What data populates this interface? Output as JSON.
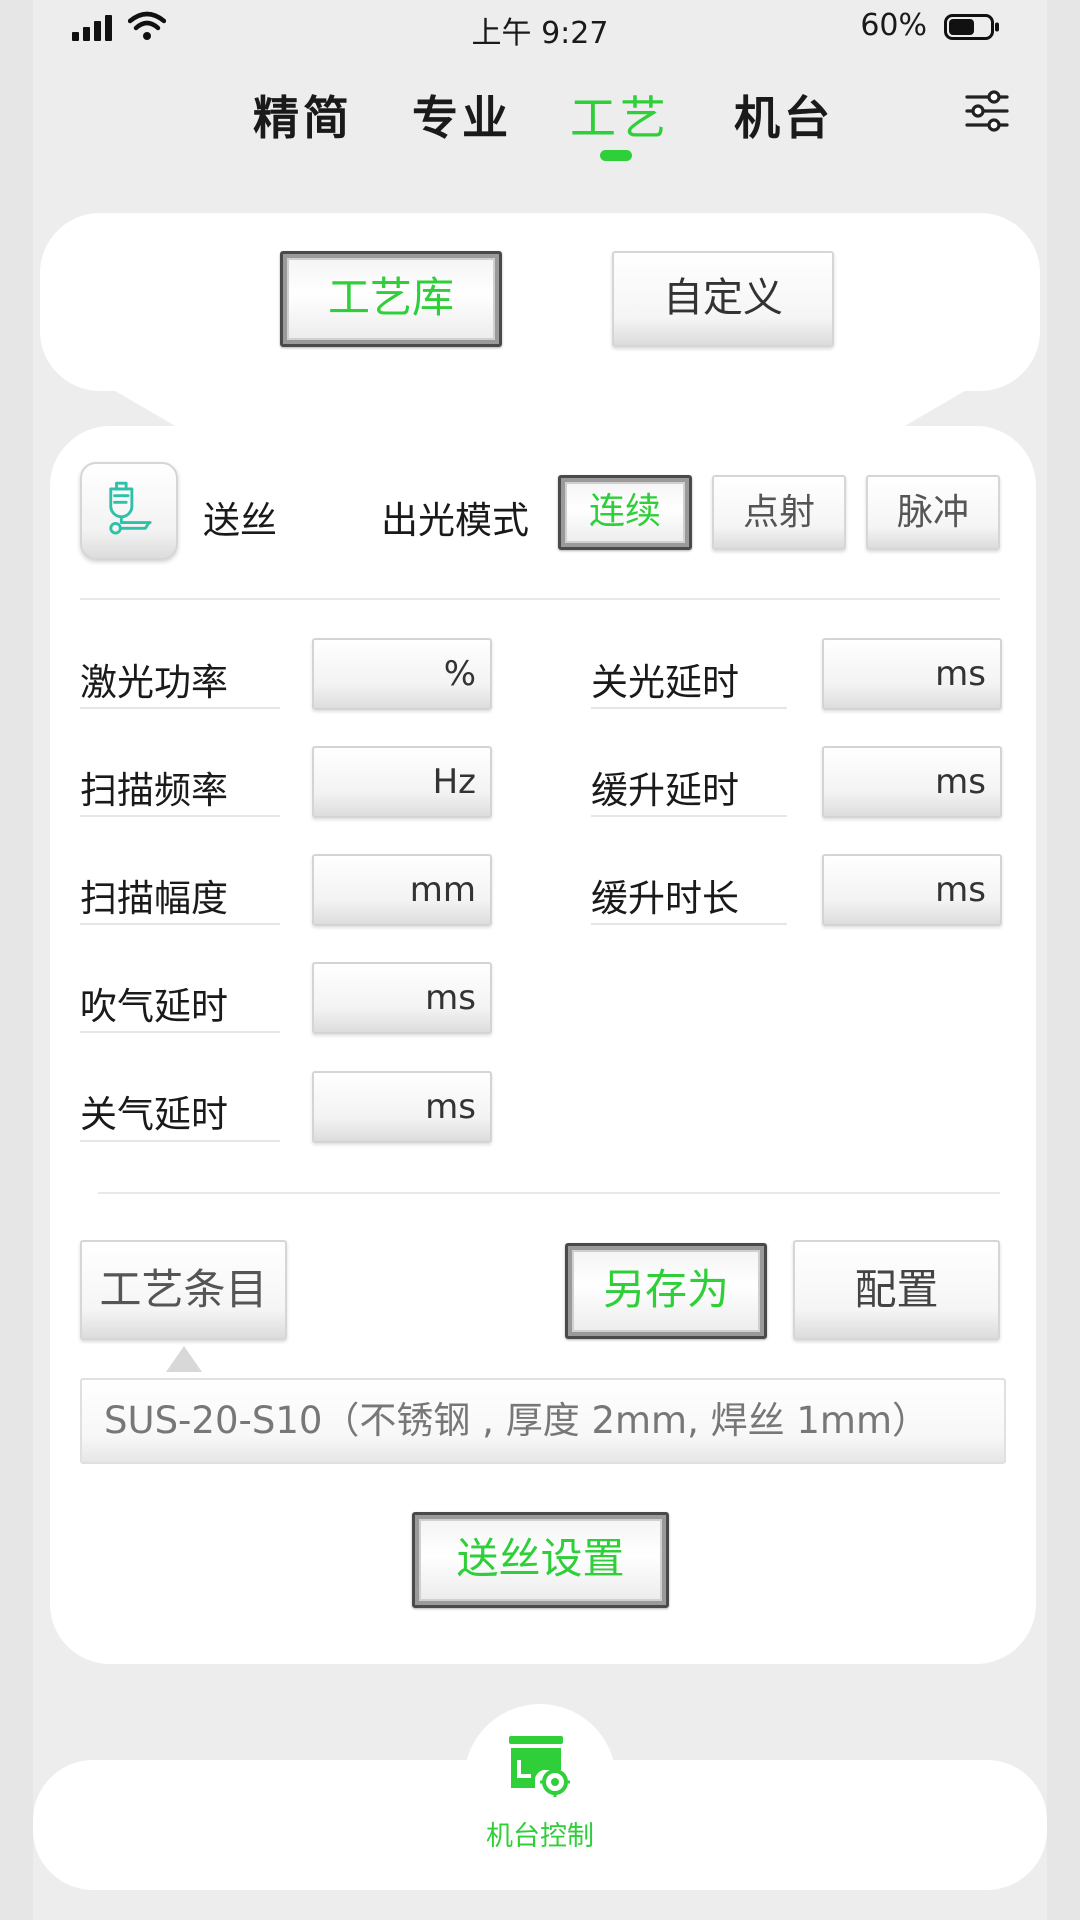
{
  "status_bar": {
    "time": "上午 9:27",
    "battery": "60%"
  },
  "tabs": [
    {
      "label": "精简"
    },
    {
      "label": "专业"
    },
    {
      "label": "工艺",
      "active": true
    },
    {
      "label": "机台"
    }
  ],
  "mode_buttons": {
    "library": "工艺库",
    "custom": "自定义"
  },
  "wire": {
    "label": "送丝"
  },
  "emission": {
    "label": "出光模式",
    "options": [
      "连续",
      "点射",
      "脉冲"
    ],
    "selected": "连续"
  },
  "params_left": [
    {
      "label": "激光功率",
      "unit": "%"
    },
    {
      "label": "扫描频率",
      "unit": "Hz"
    },
    {
      "label": "扫描幅度",
      "unit": "mm"
    },
    {
      "label": "吹气延时",
      "unit": "ms"
    },
    {
      "label": "关气延时",
      "unit": "ms"
    }
  ],
  "params_right": [
    {
      "label": "关光延时",
      "unit": "ms"
    },
    {
      "label": "缓升延时",
      "unit": "ms"
    },
    {
      "label": "缓升时长",
      "unit": "ms"
    }
  ],
  "actions": {
    "recipe_entry": "工艺条目",
    "save_as": "另存为",
    "config": "配置"
  },
  "recipe": {
    "current": "SUS-20-S10（不锈钢 , 厚度 2mm, 焊丝 1mm）"
  },
  "wire_settings": "送丝设置",
  "bottom_nav": {
    "label": "机台控制"
  },
  "colors": {
    "accent": "#2fcf3a",
    "background": "#ededed",
    "card": "#ffffff"
  }
}
